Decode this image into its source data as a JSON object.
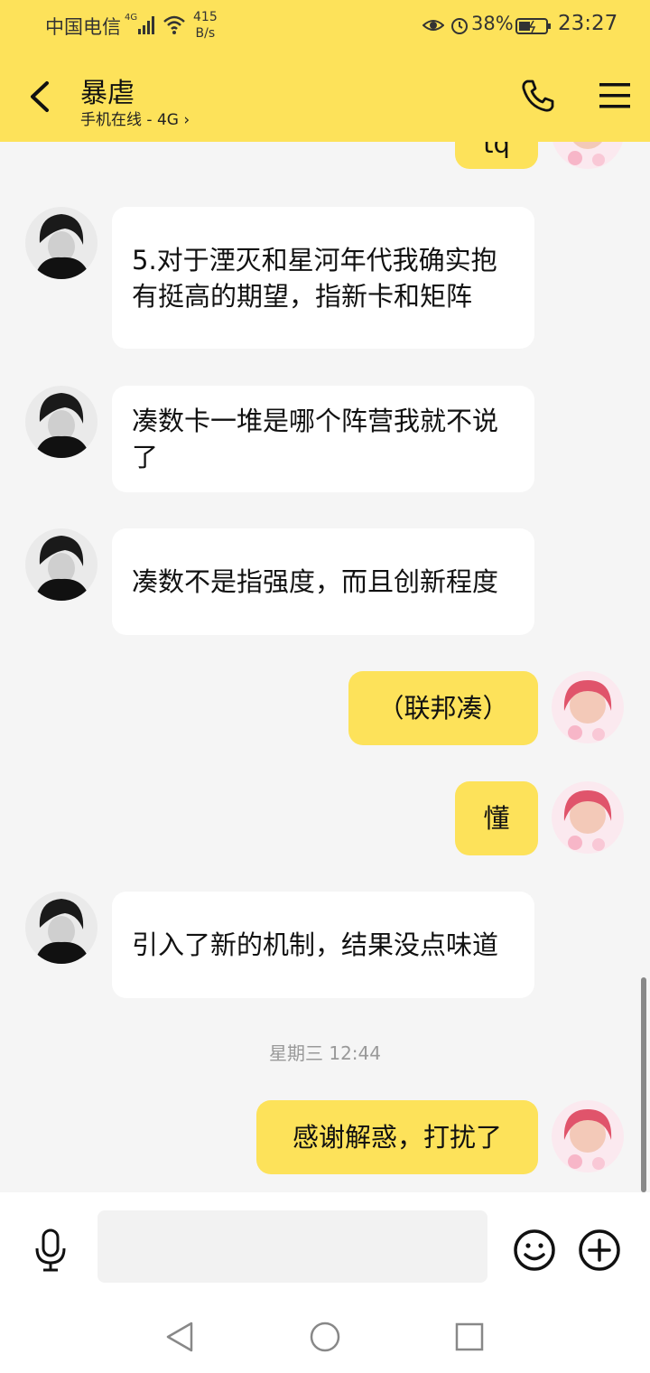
{
  "status_bar": {
    "carrier": "中国电信",
    "network": "4G",
    "speed_value": "415",
    "speed_unit": "B/s",
    "battery": "38%",
    "time": "23:27"
  },
  "header": {
    "contact_name": "暴虐",
    "subtitle": "手机在线 - 4G",
    "subtitle_chevron": "›"
  },
  "messages": [
    {
      "side": "out",
      "text": "tq"
    },
    {
      "side": "in",
      "text": "5.对于湮灭和星河年代我确实抱有挺高的期望，指新卡和矩阵"
    },
    {
      "side": "in",
      "text": "凑数卡一堆是哪个阵营我就不说了"
    },
    {
      "side": "in",
      "text": "凑数不是指强度，而且创新程度"
    },
    {
      "side": "out",
      "text": "（联邦凑）"
    },
    {
      "side": "out",
      "text": "懂"
    },
    {
      "side": "in",
      "text": "引入了新的机制，结果没点味道"
    },
    {
      "side": "out",
      "text": "感谢解惑，打扰了"
    }
  ],
  "timestamp": "星期三 12:44",
  "input": {
    "placeholder": ""
  },
  "colors": {
    "accent": "#fde25a",
    "background": "#f5f5f5"
  }
}
